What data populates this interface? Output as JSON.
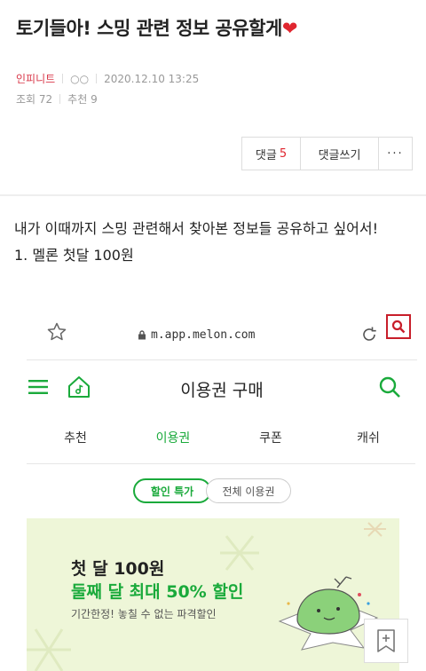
{
  "post": {
    "title": "토기들아! 스밍 관련 정보 공유할게",
    "title_heart": "❤",
    "author": "인피니트",
    "author_sub": "○○",
    "datetime": "2020.12.10 13:25",
    "views": "조회 72",
    "recommends": "추천 9"
  },
  "actions": {
    "comment_label": "댓글",
    "comment_count": "5",
    "write_comment": "댓글쓰기",
    "more": "···"
  },
  "body": {
    "line1": "내가 이때까지 스밍 관련해서 찾아본 정보들 공유하고 싶어서!",
    "line2": "1. 멜론 첫달 100원"
  },
  "embedded": {
    "url": "m.app.melon.com",
    "header_title": "이용권 구매",
    "tabs": [
      "추천",
      "이용권",
      "쿠폰",
      "캐쉬"
    ],
    "active_tab": "이용권",
    "pills": [
      "할인 특가",
      "전체 이용권"
    ],
    "banner": {
      "line1": "첫 달 100원",
      "line2": "둘째 달 최대 50% 할인",
      "line3": "기간한정! 놓칠 수 없는 파격할인"
    },
    "accent_color": "#1aaa3b"
  },
  "icons": [
    "star-icon",
    "lock-icon",
    "reload-icon",
    "search-icon",
    "hamburger-icon",
    "home-icon",
    "bookmark-add-icon"
  ]
}
